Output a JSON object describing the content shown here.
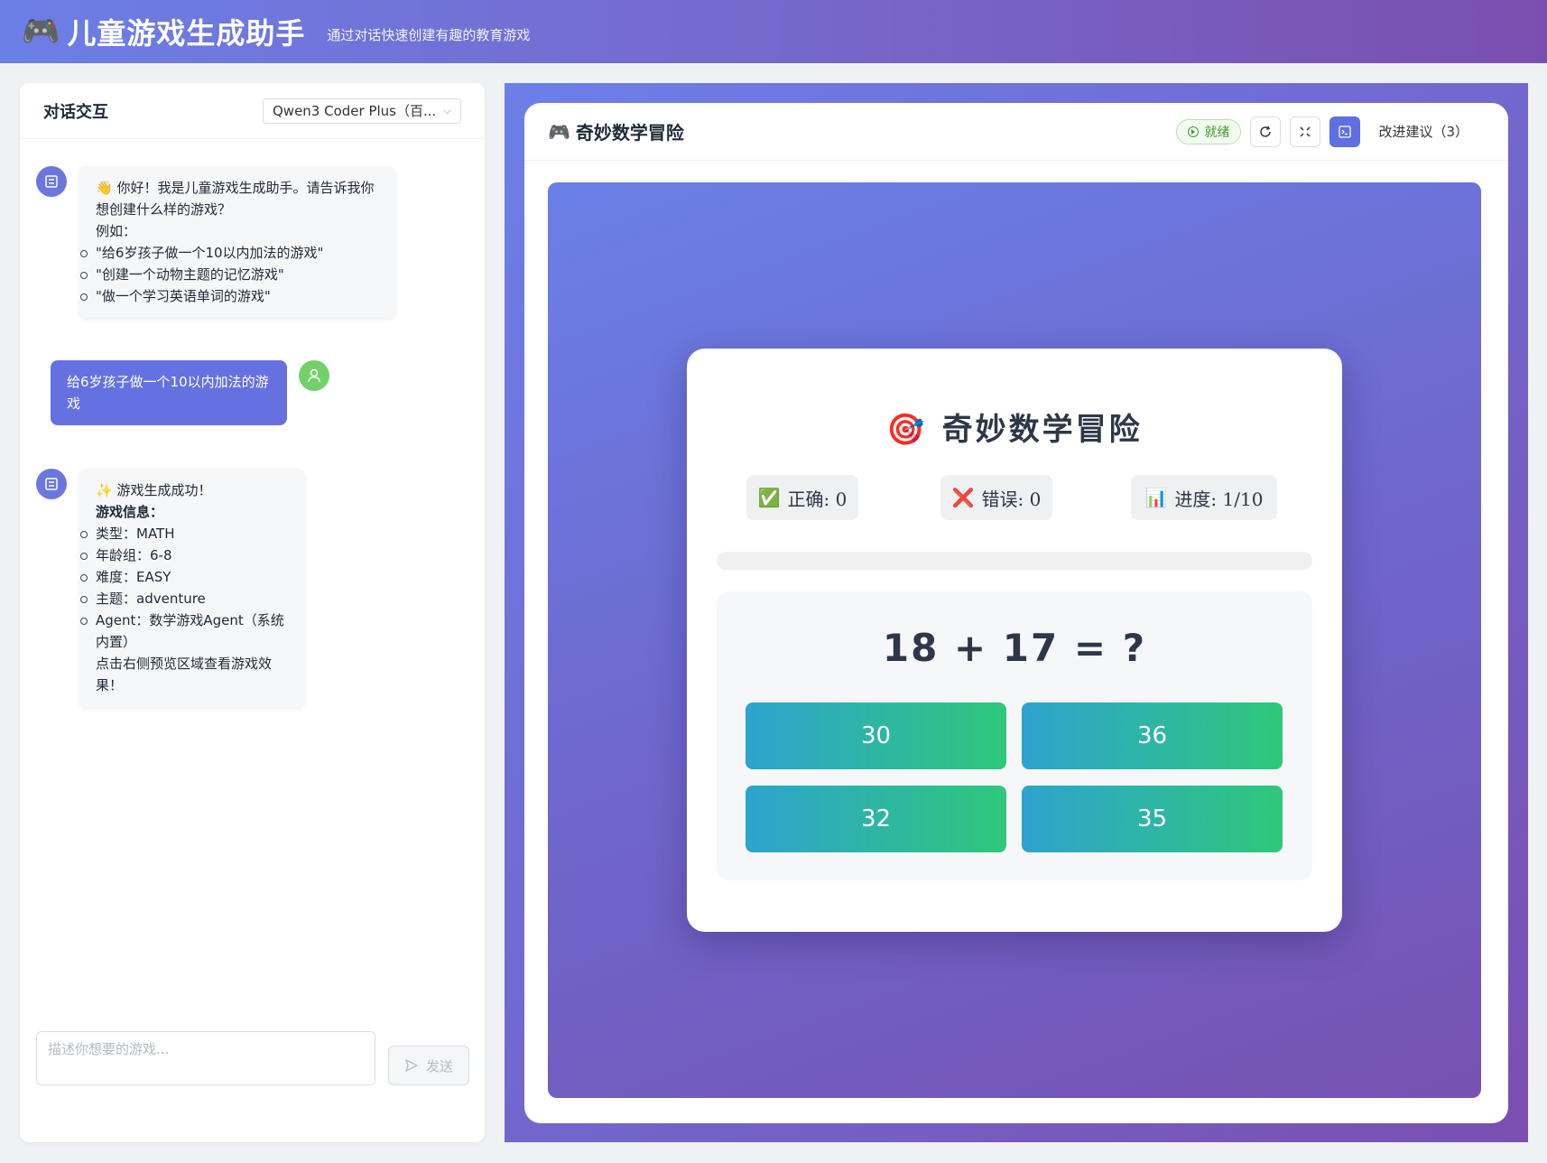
{
  "header": {
    "logo_icon": "🎮",
    "title": "儿童游戏生成助手",
    "subtitle": "通过对话快速创建有趣的教育游戏"
  },
  "chat": {
    "title": "对话交互",
    "model_select": "Qwen3 Coder Plus（百...",
    "messages": [
      {
        "role": "bot",
        "intro": "👋 你好！我是儿童游戏生成助手。请告诉我你想创建什么样的游戏？",
        "example_label": "例如：",
        "examples": [
          "\"给6岁孩子做一个10以内加法的游戏\"",
          "\"创建一个动物主题的记忆游戏\"",
          "\"做一个学习英语单词的游戏\""
        ]
      },
      {
        "role": "user",
        "text": "给6岁孩子做一个10以内加法的游戏"
      },
      {
        "role": "bot",
        "intro": "✨ 游戏生成成功！",
        "info_label": "游戏信息：",
        "items": [
          "类型：MATH",
          "年龄组：6-8",
          "难度：EASY",
          "主题：adventure",
          "Agent：数学游戏Agent（系统内置）"
        ],
        "footer": "点击右侧预览区域查看游戏效果！"
      }
    ],
    "input_placeholder": "描述你想要的游戏...",
    "send_label": "发送"
  },
  "preview": {
    "game_icon": "🎮",
    "game_title": "奇妙数学冒险",
    "status": "就绪",
    "suggest_label": "改进建议（3）"
  },
  "game": {
    "heading_icon": "🎯",
    "heading": "奇妙数学冒险",
    "stats": {
      "correct_icon": "✅",
      "correct_label": "正确: ",
      "correct_value": "0",
      "wrong_icon": "❌",
      "wrong_label": "错误: ",
      "wrong_value": "0",
      "progress_icon": "📊",
      "progress_label": "进度: ",
      "progress_value": "1/10"
    },
    "progress_fraction": 0,
    "question": "18 + 17 = ?",
    "answers": [
      "30",
      "36",
      "32",
      "35"
    ]
  },
  "colors": {
    "accent": "#6571e0",
    "bot_avatar": "#6a77df",
    "user_avatar": "#72d169",
    "status_green": "#3f9a2f"
  },
  "icons": {
    "bot_avatar": "robot-icon",
    "user_avatar": "user-icon",
    "refresh": "refresh-icon",
    "fullscreen": "fullscreen-icon",
    "console": "terminal-icon",
    "send": "send-icon",
    "status": "play-circle-icon"
  }
}
